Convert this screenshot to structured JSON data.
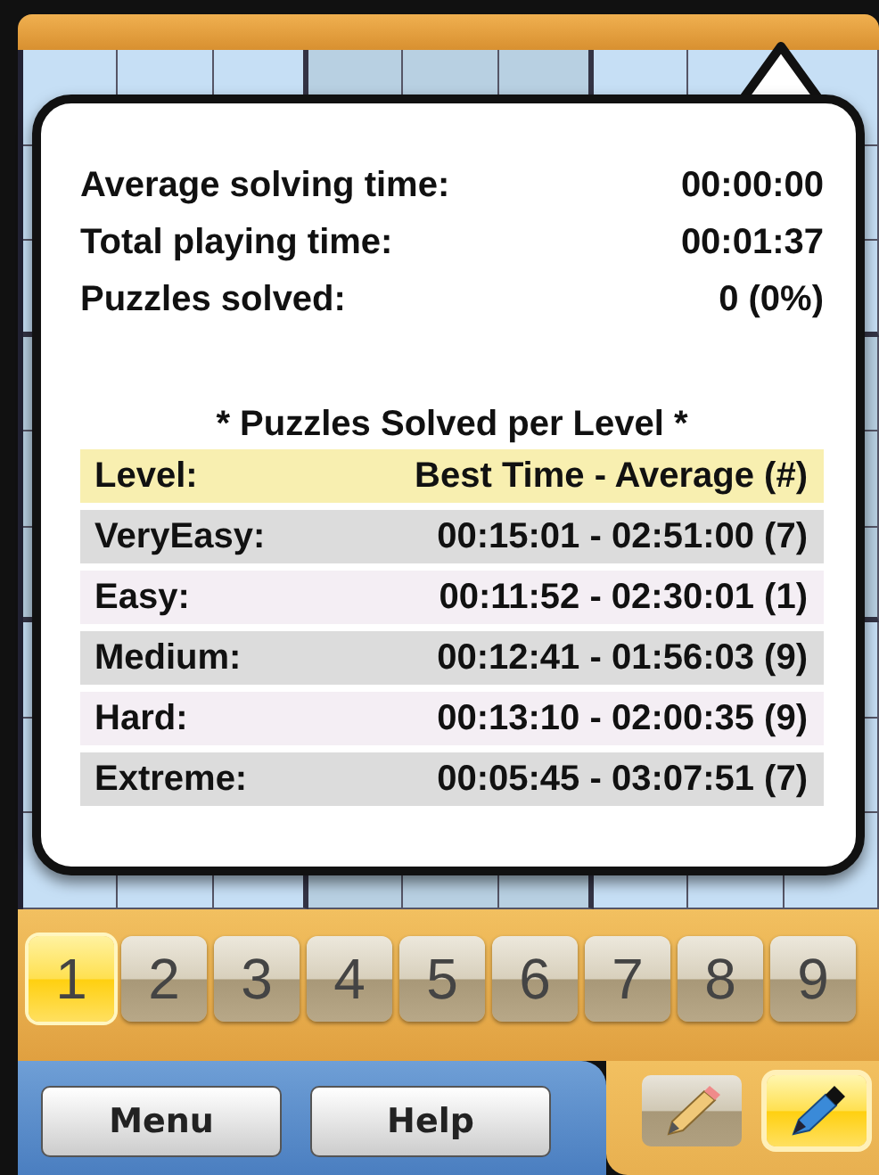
{
  "stats": [
    {
      "label": "Average solving time:",
      "value": "00:00:00"
    },
    {
      "label": "Total playing time:",
      "value": "00:01:37"
    },
    {
      "label": "Puzzles solved:",
      "value": "0 (0%)"
    }
  ],
  "section_title": "* Puzzles Solved per Level *",
  "table": {
    "columns": [
      "Level:",
      "Best Time - Average (#)"
    ],
    "rows": [
      {
        "level": "VeryEasy:",
        "times": "00:15:01 - 02:51:00 (7)"
      },
      {
        "level": "Easy:",
        "times": "00:11:52 - 02:30:01 (1)"
      },
      {
        "level": "Medium:",
        "times": "00:12:41 - 01:56:03 (9)"
      },
      {
        "level": "Hard:",
        "times": "00:13:10 - 02:00:35 (9)"
      },
      {
        "level": "Extreme:",
        "times": "00:05:45 - 03:07:51 (7)"
      }
    ]
  },
  "digits": [
    {
      "label": "1",
      "selected": true
    },
    {
      "label": "2",
      "selected": false
    },
    {
      "label": "3",
      "selected": false
    },
    {
      "label": "4",
      "selected": false
    },
    {
      "label": "5",
      "selected": false
    },
    {
      "label": "6",
      "selected": false
    },
    {
      "label": "7",
      "selected": false
    },
    {
      "label": "8",
      "selected": false
    },
    {
      "label": "9",
      "selected": false
    }
  ],
  "buttons": [
    "Menu",
    "Help"
  ],
  "tools": [
    {
      "kind": "pencil",
      "selected": false
    },
    {
      "kind": "pen",
      "selected": true
    }
  ]
}
